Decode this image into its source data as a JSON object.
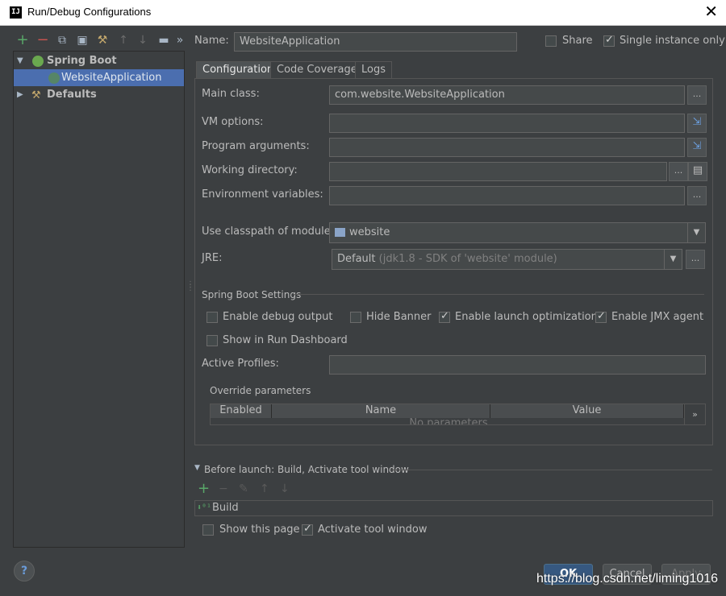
{
  "window": {
    "title": "Run/Debug Configurations",
    "icon": "intellij-icon",
    "close": "✕"
  },
  "toolbar": {
    "icons": [
      "add-icon",
      "remove-icon",
      "copy-icon",
      "save-icon",
      "edit-defaults-icon",
      "move-up-icon",
      "move-down-icon",
      "folder-icon",
      "more-icon"
    ],
    "glyphs": {
      "add": "+",
      "remove": "−",
      "copy": "⧉",
      "save": "▣",
      "wrench": "⚒",
      "up": "↑",
      "down": "↓",
      "folder": "▬",
      "more": "»"
    }
  },
  "tree": {
    "spring_boot": "Spring Boot",
    "website_application": "WebsiteApplication",
    "defaults": "Defaults"
  },
  "name_field": {
    "label": "Name:",
    "value": "WebsiteApplication"
  },
  "share": {
    "label": "Share",
    "checked": false
  },
  "single_instance": {
    "label": "Single instance only",
    "checked": true
  },
  "tabs": [
    "Configuration",
    "Code Coverage",
    "Logs"
  ],
  "config": {
    "main_class": {
      "label": "Main class:",
      "value": "com.website.WebsiteApplication"
    },
    "vm_options": {
      "label": "VM options:",
      "value": ""
    },
    "program_arguments": {
      "label": "Program arguments:",
      "value": ""
    },
    "working_directory": {
      "label": "Working directory:",
      "value": ""
    },
    "environment_variables": {
      "label": "Environment variables:",
      "value": ""
    },
    "classpath_module": {
      "label": "Use classpath of module:",
      "value": "website"
    },
    "jre": {
      "label": "JRE:",
      "value": "Default",
      "hint": "(jdk1.8 - SDK of 'website' module)"
    },
    "browse": "...",
    "dropdown": "▼"
  },
  "spring_boot_settings": {
    "header": "Spring Boot Settings",
    "enable_debug_output": {
      "label": "Enable debug output",
      "checked": false
    },
    "hide_banner": {
      "label": "Hide Banner",
      "checked": false
    },
    "enable_launch_optimization": {
      "label": "Enable launch optimization",
      "checked": true
    },
    "enable_jmx_agent": {
      "label": "Enable JMX agent",
      "checked": true
    },
    "show_in_run_dashboard": {
      "label": "Show in Run Dashboard",
      "checked": false
    },
    "active_profiles": {
      "label": "Active Profiles:",
      "value": ""
    },
    "override_parameters": {
      "header": "Override parameters",
      "columns": [
        "Enabled",
        "Name",
        "Value"
      ],
      "empty_text": "No parameters",
      "more": "»"
    }
  },
  "before_launch": {
    "header": "Before launch: Build, Activate tool window",
    "items": [
      "Build"
    ],
    "build_icon": "build-icon",
    "show_this_page": {
      "label": "Show this page",
      "checked": false
    },
    "activate_tool_window": {
      "label": "Activate tool window",
      "checked": true
    }
  },
  "buttons": {
    "help": "?",
    "ok": "OK",
    "cancel": "Cancel",
    "apply": "Apply"
  },
  "watermark": "https://blog.csdn.net/liming1016",
  "colors": {
    "background": "#3c3f41",
    "selection": "#4b6eaf",
    "field": "#45494a",
    "add_green": "#59a869",
    "remove_red": "#c75450"
  }
}
